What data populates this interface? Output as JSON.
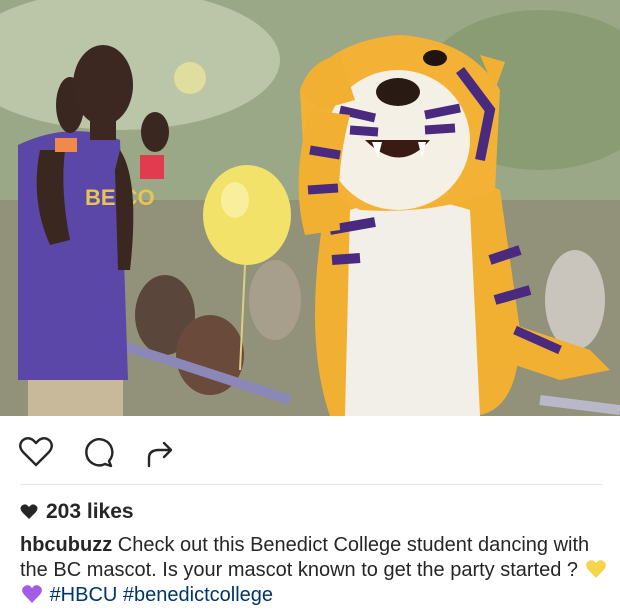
{
  "post": {
    "image": {
      "description_icons": [
        "photo-scene"
      ]
    },
    "actions": {
      "like_icon": "heart-outline-icon",
      "comment_icon": "comment-bubble-icon",
      "share_icon": "share-arrow-icon"
    },
    "likes_text": "203 likes",
    "caption": {
      "username": "hbcubuzz",
      "text": "Check out this Benedict College student dancing with the BC mascot. Is your mascot known to get the party started ?",
      "emoji_1": "yellow-heart-emoji",
      "emoji_2": "purple-heart-emoji",
      "hashtag_1": "#HBCU",
      "hashtag_2": "#benedictcollege"
    },
    "shirt_lettering": "BE CO",
    "colors": {
      "hashtag": "#003569",
      "text": "#262626",
      "yellow_heart": "#f6d44c",
      "purple_heart": "#a35ce6"
    }
  }
}
